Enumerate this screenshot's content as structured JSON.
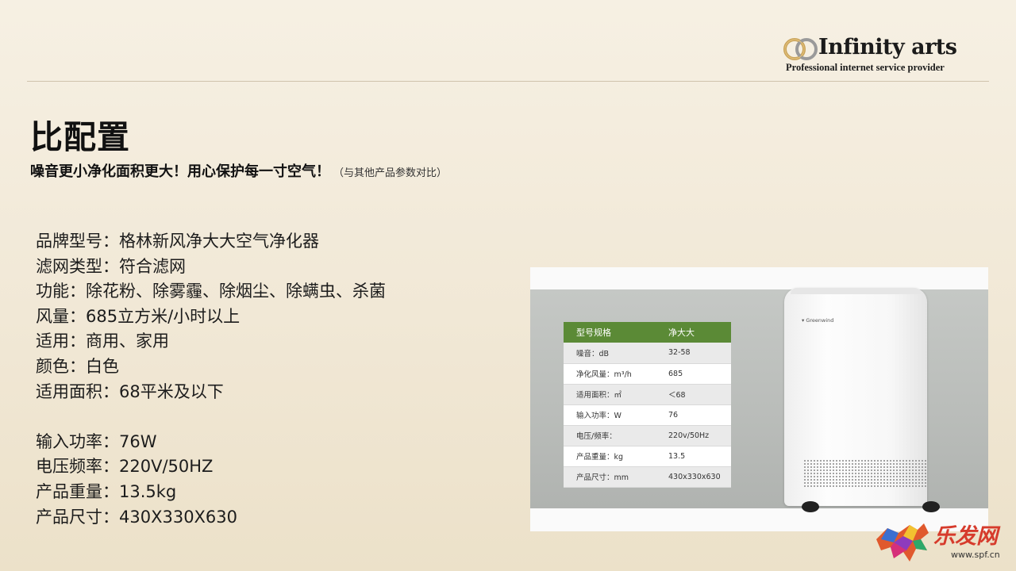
{
  "logo": {
    "title": "Infinity arts",
    "tagline": "Professional internet service provider"
  },
  "page": {
    "title": "比配置",
    "subtitle": "噪音更小净化面积更大！用心保护每一寸空气！",
    "subtitle_note": "（与其他产品参数对比）"
  },
  "specs": {
    "group1": [
      "品牌型号：格林新风净大大空气净化器",
      "滤网类型：符合滤网",
      "功能：除花粉、除雾霾、除烟尘、除螨虫、杀菌",
      "风量：685立方米/小时以上",
      "适用：商用、家用",
      "颜色：白色",
      "适用面积：68平米及以下"
    ],
    "group2": [
      "输入功率：76W",
      "电压频率：220V/50HZ",
      "产品重量：13.5kg",
      "产品尺寸：430X330X630"
    ]
  },
  "product_table": {
    "headers": [
      "型号规格",
      "净大大"
    ],
    "rows": [
      [
        "噪音：dB",
        "32-58"
      ],
      [
        "净化风量：m³/h",
        "685"
      ],
      [
        "适用面积：㎡",
        "＜68"
      ],
      [
        "输入功率：W",
        "76"
      ],
      [
        "电压/频率：",
        "220v/50Hz"
      ],
      [
        "产品重量：kg",
        "13.5"
      ],
      [
        "产品尺寸：mm",
        "430x330x630"
      ]
    ],
    "header_color": "#5b8a36"
  },
  "product": {
    "brand": "Greenwind"
  },
  "watermark": {
    "text": "乐发网",
    "url": "www.spf.cn"
  },
  "colors": {
    "background": "#f3ebda",
    "accent": "#5b8a36",
    "watermark": "#d63b2c"
  }
}
